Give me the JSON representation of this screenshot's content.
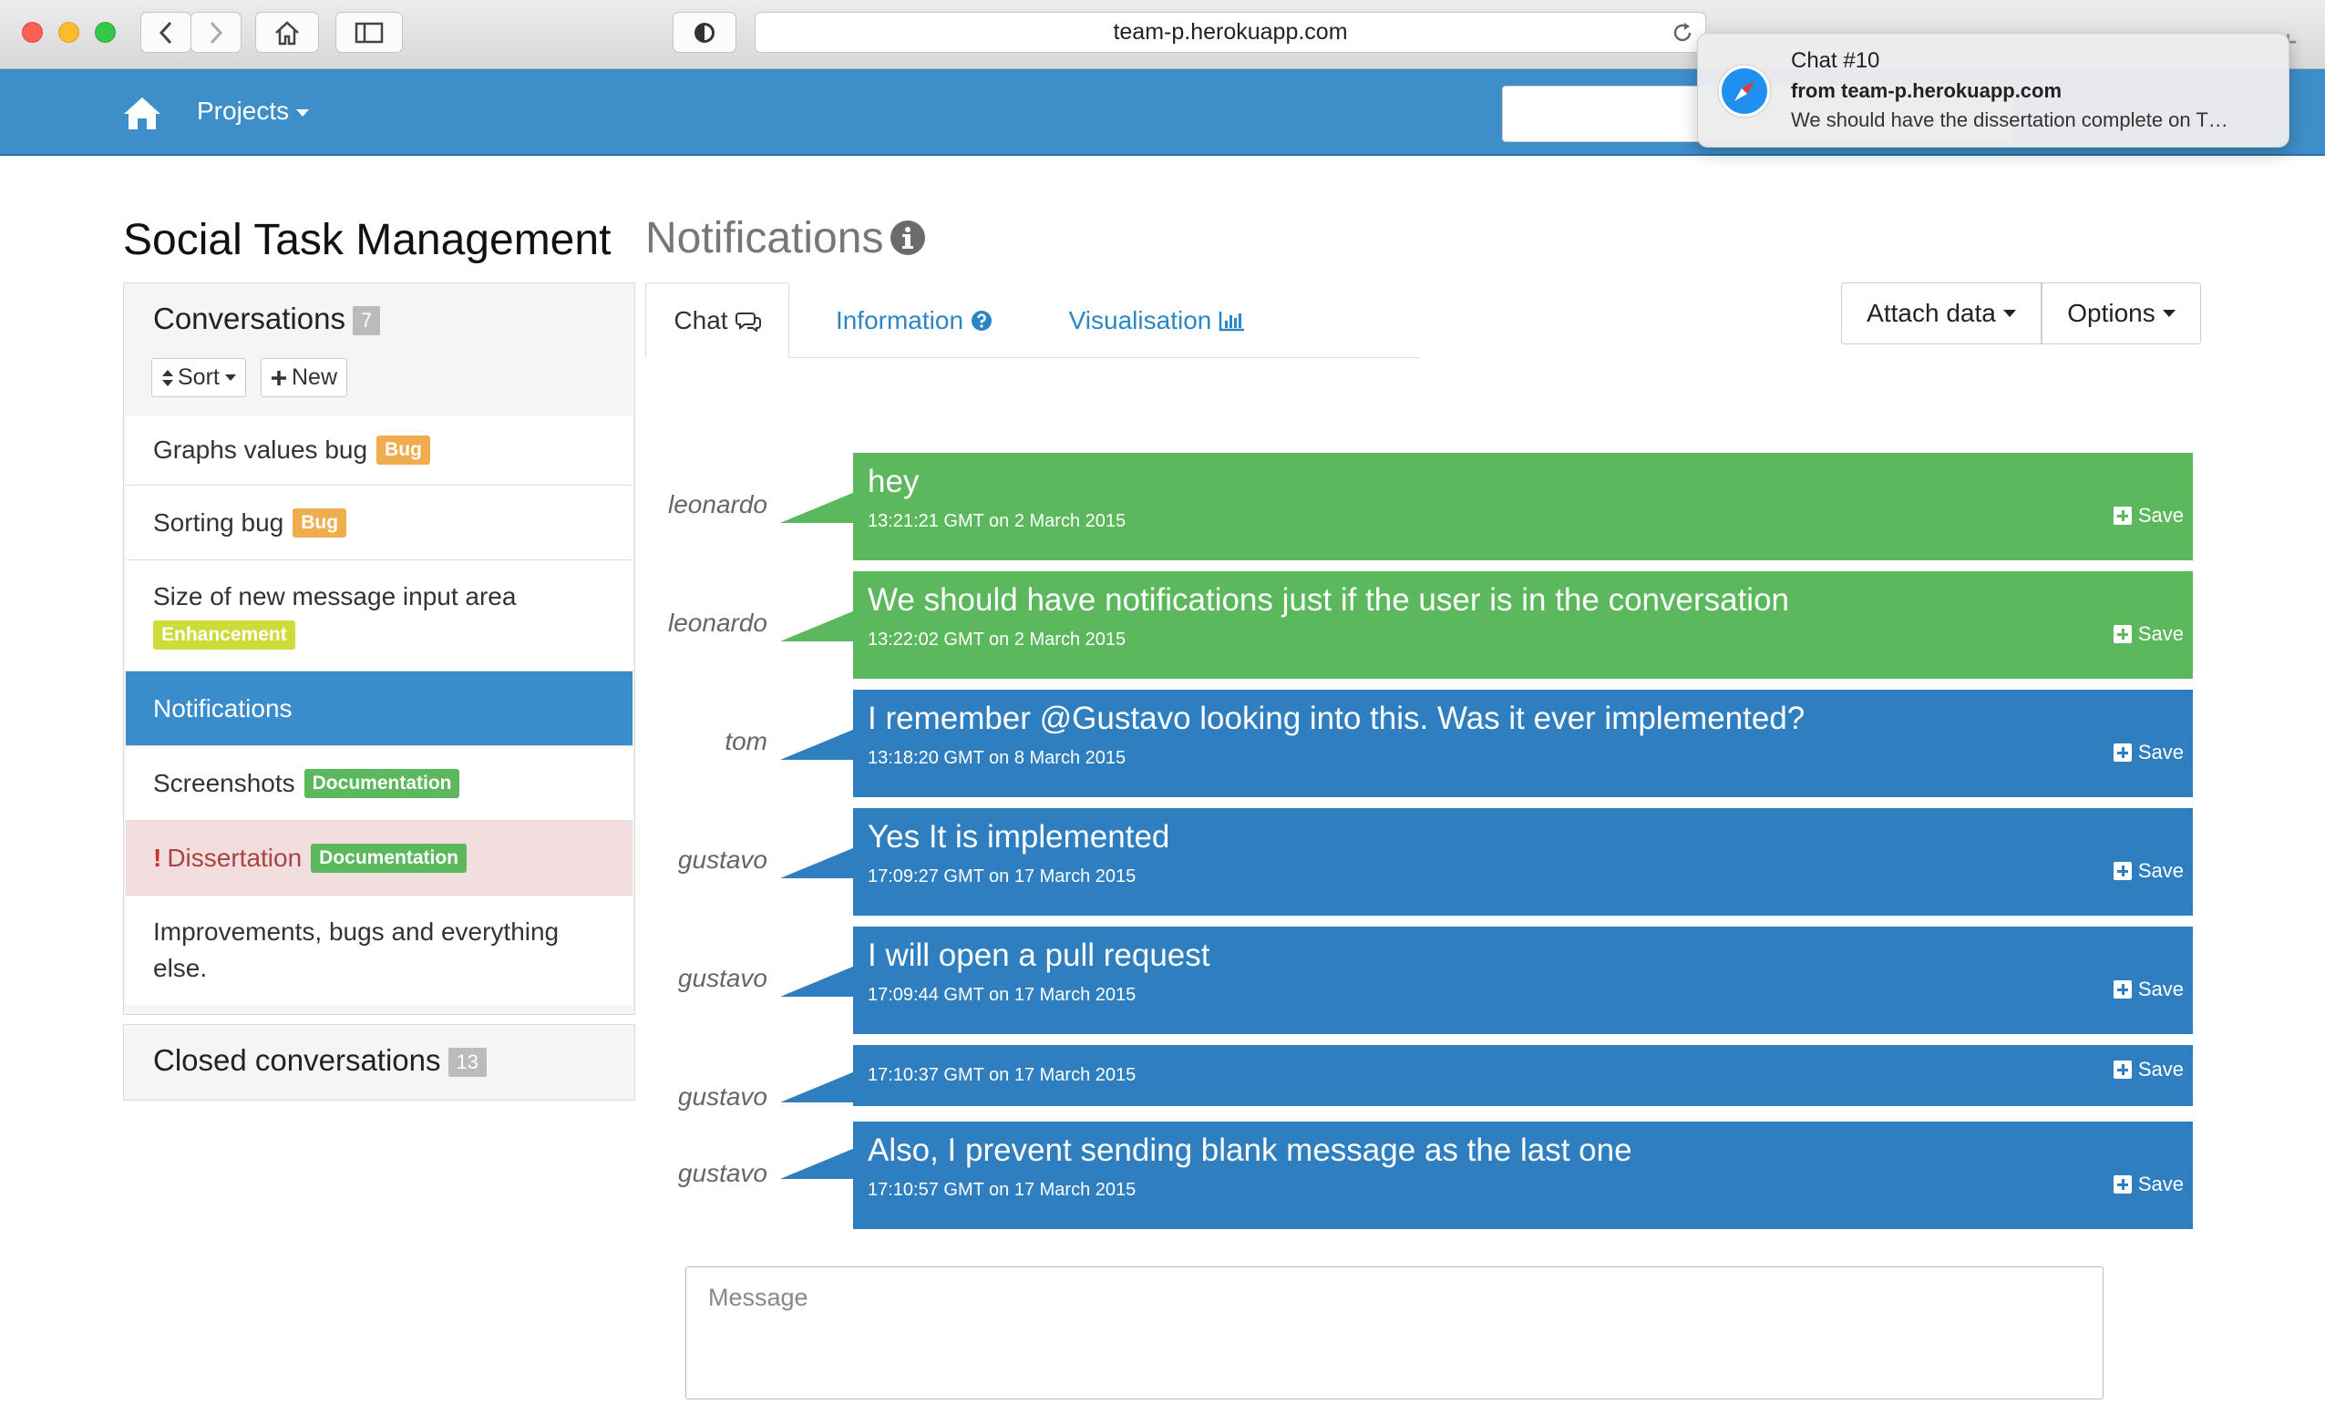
{
  "browser": {
    "url": "team-p.herokuapp.com"
  },
  "notification": {
    "title": "Chat #10",
    "from": "from team-p.herokuapp.com",
    "body": "We should have the dissertation complete on T…"
  },
  "navbar": {
    "projects_label": "Projects"
  },
  "page": {
    "title": "Social Task Management",
    "subtitle": "Notifications"
  },
  "sidebar": {
    "title": "Conversations",
    "count": "7",
    "sort_label": "Sort",
    "new_label": "New",
    "items": [
      {
        "label": "Graphs values bug",
        "tag": "Bug"
      },
      {
        "label": "Sorting bug",
        "tag": "Bug"
      },
      {
        "label": "Size of new message input area",
        "tag": "Enhancement"
      },
      {
        "label": "Notifications",
        "tag": ""
      },
      {
        "label": "Screenshots",
        "tag": "Documentation"
      },
      {
        "label": "Dissertation",
        "tag": "Documentation",
        "prefix": "!"
      },
      {
        "label": "Improvements, bugs and everything else.",
        "tag": ""
      }
    ],
    "closed_title": "Closed conversations",
    "closed_count": "13"
  },
  "tabs": {
    "chat": "Chat",
    "information": "Information",
    "visualisation": "Visualisation"
  },
  "actions": {
    "attach_data": "Attach data",
    "options": "Options"
  },
  "messages": [
    {
      "author": "leonardo",
      "text": "hey",
      "time": "13:21:21 GMT on 2 March 2015",
      "color": "#5cb85c"
    },
    {
      "author": "leonardo",
      "text": "We should have notifications just if the user is in the conversation",
      "time": "13:22:02 GMT on 2 March 2015",
      "color": "#5cb85c"
    },
    {
      "author": "tom",
      "text": "I remember @Gustavo looking into this. Was it ever implemented?",
      "time": "13:18:20 GMT on 8 March 2015",
      "color": "#2f7fc0"
    },
    {
      "author": "gustavo",
      "text": "Yes It is implemented",
      "time": "17:09:27 GMT on 17 March 2015",
      "color": "#2f7fc0"
    },
    {
      "author": "gustavo",
      "text": "I will open a pull request",
      "time": "17:09:44 GMT on 17 March 2015",
      "color": "#2f7fc0"
    },
    {
      "author": "gustavo",
      "text": "",
      "time": "17:10:37 GMT on 17 March 2015",
      "color": "#2f7fc0"
    },
    {
      "author": "gustavo",
      "text": "Also, I prevent sending blank message as the last one",
      "time": "17:10:57 GMT on 17 March 2015",
      "color": "#2f7fc0"
    }
  ],
  "save_label": "Save",
  "composer": {
    "placeholder": "Message"
  }
}
